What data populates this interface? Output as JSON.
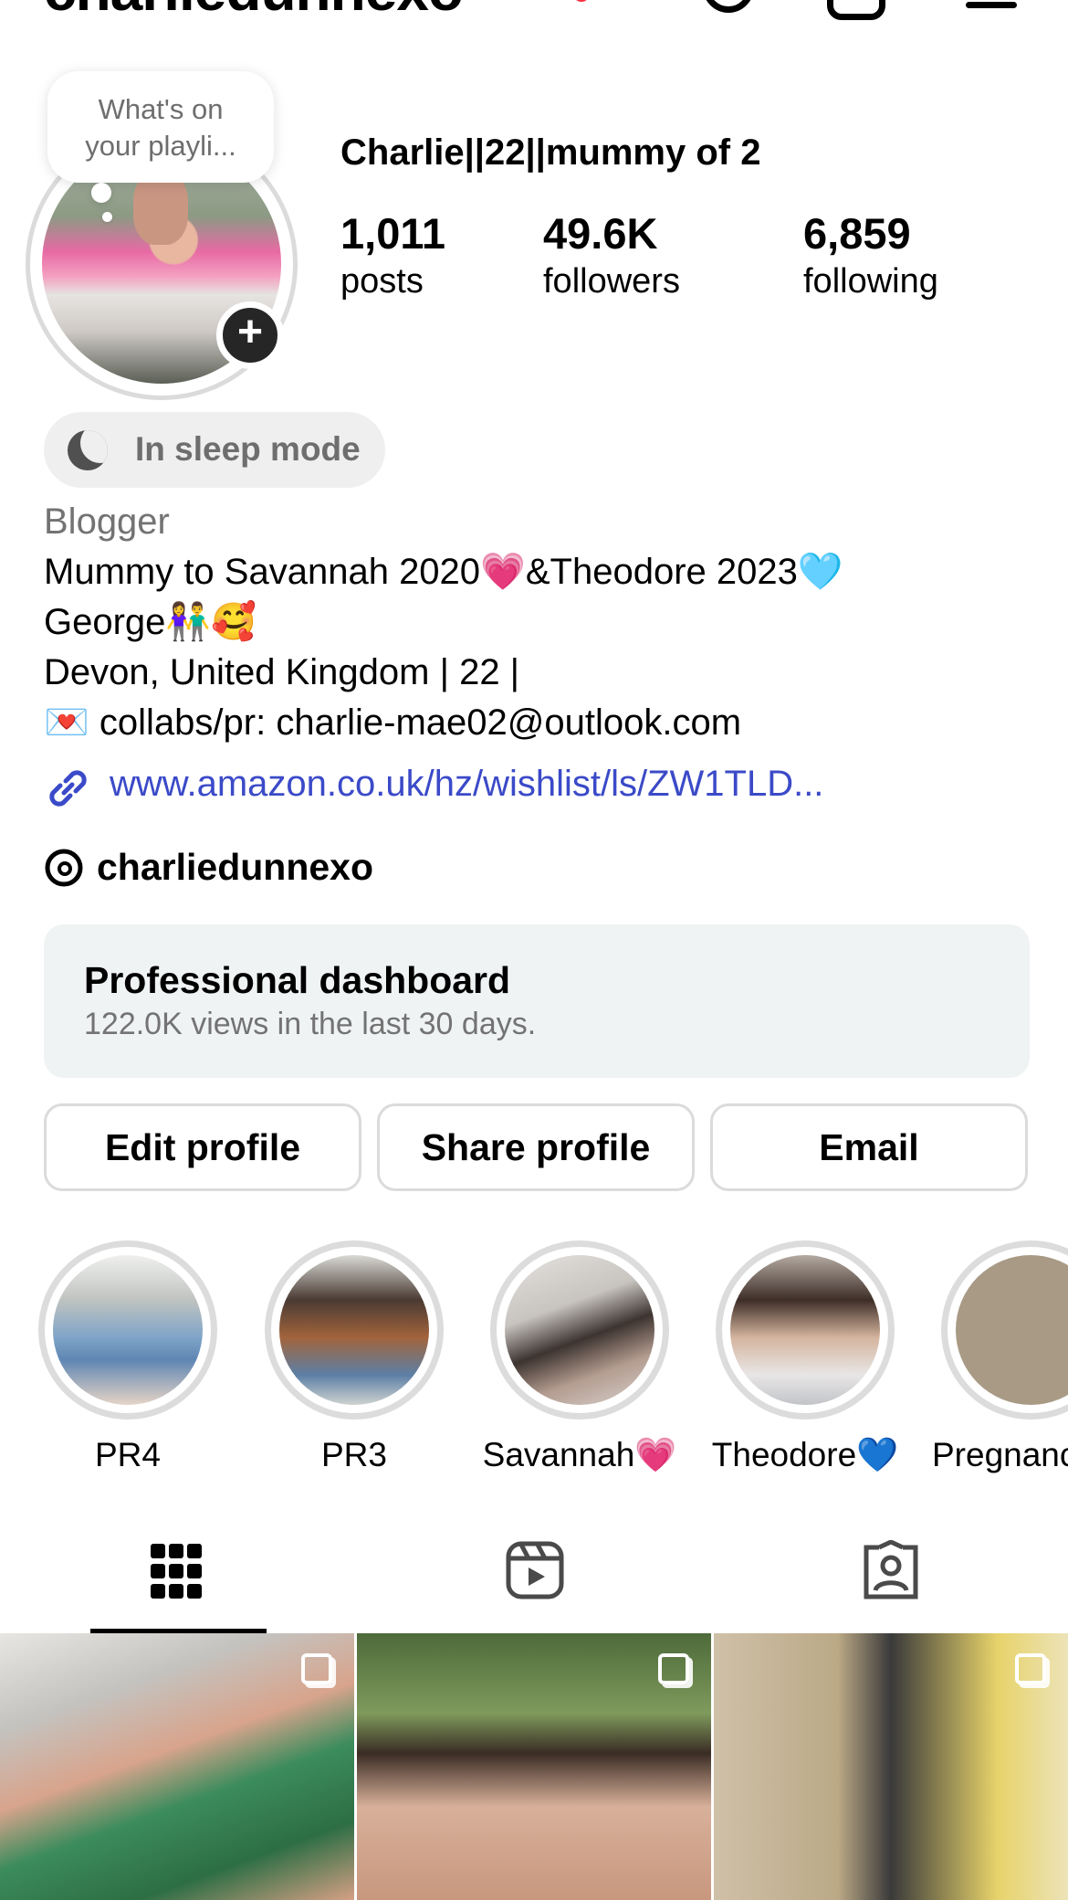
{
  "header": {
    "username": "charliedunnexo"
  },
  "note": {
    "line1": "What's on",
    "line2": "your playli..."
  },
  "profile": {
    "display_name": "Charlie||22||mummy of 2",
    "stats": {
      "posts_count": "1,011",
      "posts_label": "posts",
      "followers_count": "49.6K",
      "followers_label": "followers",
      "following_count": "6,859",
      "following_label": "following"
    },
    "add_story_glyph": "+",
    "sleep_mode": "In sleep mode",
    "category": "Blogger",
    "bio": [
      "Mummy to Savannah 2020💗&Theodore 2023🩵",
      "George👫🥰",
      "Devon, United Kingdom | 22 |",
      "💌 collabs/pr: charlie-mae02@outlook.com"
    ],
    "link": "www.amazon.co.uk/hz/wishlist/ls/ZW1TLD...",
    "threads_handle": "charliedunnexo"
  },
  "dashboard": {
    "title": "Professional dashboard",
    "subtitle": "122.0K views in the last 30 days."
  },
  "buttons": {
    "edit": "Edit profile",
    "share": "Share profile",
    "email": "Email"
  },
  "highlights": [
    {
      "label": "PR4"
    },
    {
      "label": "PR3"
    },
    {
      "label": "Savannah💗"
    },
    {
      "label": "Theodore💙"
    },
    {
      "label": "Pregnanc"
    }
  ],
  "tabs": [
    "grid-icon",
    "reels-icon",
    "tagged-icon"
  ],
  "colors": {
    "link": "#3b4ac8",
    "secondary_text": "#737373",
    "dashboard_bg": "#f0f3f4",
    "notification_dot": "#ff3040"
  }
}
